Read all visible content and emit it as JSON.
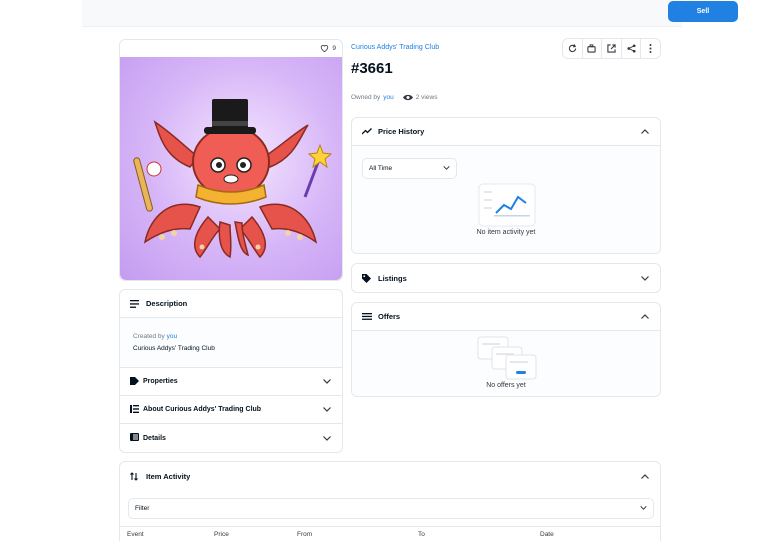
{
  "topbar": {
    "sell_label": "Sell"
  },
  "item": {
    "favorites": "9",
    "collection": "Curious Addys' Trading Club",
    "token_id": "#3661",
    "owned_by_prefix": "Owned by",
    "owner": "you",
    "views": "2 views"
  },
  "description": {
    "title": "Description",
    "created_by_prefix": "Created by",
    "creator": "you",
    "collection_name": "Curious Addys' Trading Club"
  },
  "sections": {
    "properties": "Properties",
    "about": "About Curious Addys' Trading Club",
    "details": "Details"
  },
  "price_history": {
    "title": "Price History",
    "range_value": "All Time",
    "empty": "No item activity yet"
  },
  "listings": {
    "title": "Listings"
  },
  "offers": {
    "title": "Offers",
    "empty": "No offers yet"
  },
  "activity": {
    "title": "Item Activity",
    "filter_placeholder": "Filter",
    "columns": [
      "Event",
      "Price",
      "From",
      "To",
      "Date"
    ]
  },
  "colors": {
    "accent": "#2081e2",
    "border": "#e5e8eb",
    "text": "#04111d"
  },
  "icons": [
    "heart-icon",
    "refresh-icon",
    "transfer-icon",
    "external-link-icon",
    "share-icon",
    "more-icon",
    "price-history-icon",
    "listings-tag-icon",
    "offers-list-icon",
    "description-lines-icon",
    "properties-tag-icon",
    "about-icon",
    "details-icon",
    "activity-sort-icon",
    "chevron-up-icon",
    "chevron-down-icon",
    "eye-icon"
  ]
}
